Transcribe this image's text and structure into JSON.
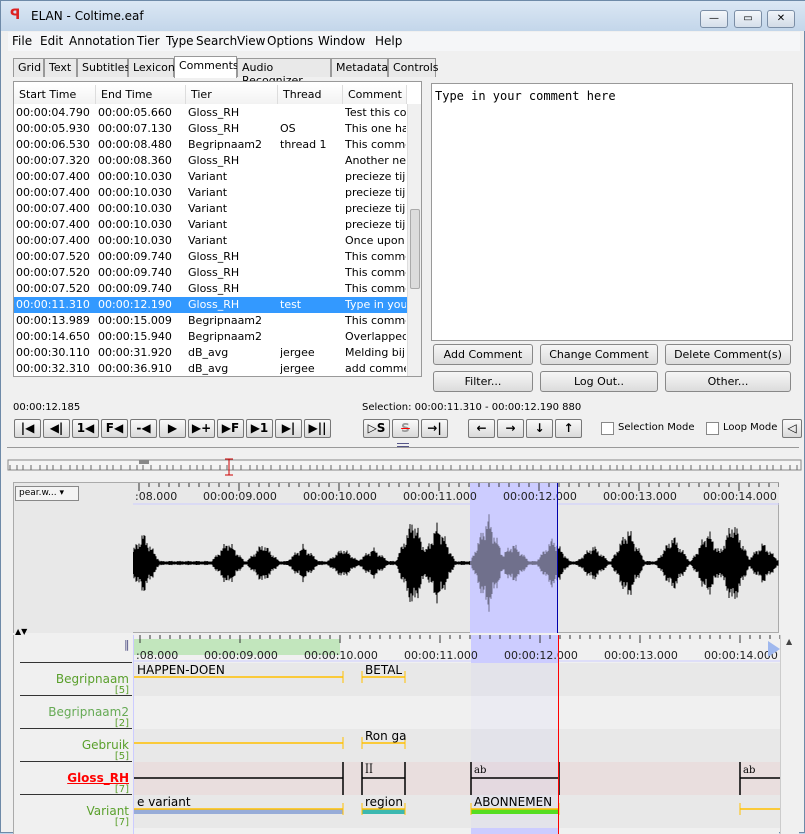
{
  "window": {
    "title": "ELAN - Coltime.eaf",
    "controls": [
      "—",
      "▭",
      "✕"
    ]
  },
  "menu": [
    "File",
    "Edit",
    "Annotation",
    "Tier",
    "Type",
    "Search",
    "View",
    "Options",
    "Window",
    "Help"
  ],
  "tabs": [
    {
      "label": "Grid"
    },
    {
      "label": "Text"
    },
    {
      "label": "Subtitles"
    },
    {
      "label": "Lexicon"
    },
    {
      "label": "Comments",
      "active": true
    },
    {
      "label": "Audio Recognizer"
    },
    {
      "label": "Metadata"
    },
    {
      "label": "Controls"
    }
  ],
  "comments_table": {
    "columns": [
      "Start Time",
      "End Time",
      "Tier",
      "Thread",
      "Comment"
    ],
    "rows": [
      [
        "00:00:04.790",
        "00:00:05.660",
        "Gloss_RH",
        "",
        "Test this com"
      ],
      [
        "00:00:05.930",
        "00:00:07.130",
        "Gloss_RH",
        "OS",
        "This one has"
      ],
      [
        "00:00:06.530",
        "00:00:08.480",
        "Begripnaam2",
        "thread 1",
        "This commen"
      ],
      [
        "00:00:07.320",
        "00:00:08.360",
        "Gloss_RH",
        "",
        "Another new"
      ],
      [
        "00:00:07.400",
        "00:00:10.030",
        "Variant",
        "",
        "precieze tijd"
      ],
      [
        "00:00:07.400",
        "00:00:10.030",
        "Variant",
        "",
        "precieze tijd"
      ],
      [
        "00:00:07.400",
        "00:00:10.030",
        "Variant",
        "",
        "precieze tijd"
      ],
      [
        "00:00:07.400",
        "00:00:10.030",
        "Variant",
        "",
        "precieze tijd"
      ],
      [
        "00:00:07.400",
        "00:00:10.030",
        "Variant",
        "",
        "Once upon a"
      ],
      [
        "00:00:07.520",
        "00:00:09.740",
        "Gloss_RH",
        "",
        "This commen"
      ],
      [
        "00:00:07.520",
        "00:00:09.740",
        "Gloss_RH",
        "",
        "This commen"
      ],
      [
        "00:00:07.520",
        "00:00:09.740",
        "Gloss_RH",
        "",
        "This commen"
      ],
      [
        "00:00:11.310",
        "00:00:12.190",
        "Gloss_RH",
        "test",
        "Type in your"
      ],
      [
        "00:00:13.989",
        "00:00:15.009",
        "Begripnaam2",
        "",
        "This commen"
      ],
      [
        "00:00:14.650",
        "00:00:15.940",
        "Begripnaam2",
        "",
        "Overlapped"
      ],
      [
        "00:00:30.110",
        "00:00:31.920",
        "dB_avg",
        "jergee",
        "Melding bij in"
      ],
      [
        "00:00:32.310",
        "00:00:36.910",
        "dB_avg",
        "jergee",
        "add commen"
      ]
    ],
    "selected_row": 12
  },
  "comment_editor": {
    "placeholder": "Type in your comment here"
  },
  "comment_buttons": {
    "add": "Add Comment",
    "change": "Change Comment",
    "delete": "Delete Comment(s)",
    "filter": "Filter...",
    "logout": "Log Out..",
    "other": "Other..."
  },
  "media": {
    "current_time": "00:00:12.185",
    "selection": "Selection: 00:00:11.310 - 00:00:12.190  880",
    "selection_mode": "Selection Mode",
    "loop_mode": "Loop Mode",
    "waveform_track": "pear.w..."
  },
  "transport": [
    "|◀",
    "◀|",
    "1◀",
    "F◀",
    "-◀",
    "▶",
    "▶+",
    "▶F",
    "▶1",
    "▶|",
    "▶||"
  ],
  "selection_buttons": [
    "▷S",
    "S",
    "→|"
  ],
  "nav_buttons": [
    "←",
    "→",
    "↓",
    "↑"
  ],
  "timeline": {
    "ticks": [
      ":08.000",
      "00:00:09.000",
      "00:00:10.000",
      "00:00:11.000",
      "00:00:12.000",
      "00:00:13.000",
      "00:00:14.000"
    ],
    "tick_times": [
      8,
      9,
      10,
      11,
      12,
      13,
      14
    ],
    "selection_start": 11.31,
    "selection_end": 12.19,
    "crosshair": 12.185,
    "tiers": [
      {
        "name": "Begripnaam",
        "count": "[5]",
        "color": "#5aa02c",
        "annotations": [
          {
            "start": 7.4,
            "end": 10.03,
            "text": "HAPPEN-DOEN"
          },
          {
            "start": 10.22,
            "end": 10.65,
            "text": "BETAL"
          }
        ]
      },
      {
        "name": "Begripnaam2",
        "count": "[2]",
        "color": "#66aa55",
        "annotations": []
      },
      {
        "name": "Gebruik",
        "count": "[5]",
        "color": "#5aa02c",
        "annotations": [
          {
            "start": 7.4,
            "end": 10.03,
            "text": ""
          },
          {
            "start": 10.22,
            "end": 10.65,
            "text": "Ron ga"
          }
        ]
      },
      {
        "name": "Gloss_RH",
        "count": "[7]",
        "color": "#ff0000",
        "active": true,
        "annotations": [
          {
            "start": 7.4,
            "end": 10.03,
            "text": ""
          },
          {
            "start": 10.22,
            "end": 10.65,
            "text": "ꟾꟾ"
          },
          {
            "start": 11.31,
            "end": 12.19,
            "text": "ab"
          },
          {
            "start": 14.0,
            "end": 15.0,
            "text": "ab"
          }
        ]
      },
      {
        "name": "Variant",
        "count": "[7]",
        "color": "#5aa02c",
        "annotations": [
          {
            "start": 7.4,
            "end": 10.03,
            "text": "e variant",
            "bar": "#97acd8"
          },
          {
            "start": 10.22,
            "end": 10.65,
            "text": "region",
            "bar": "#3bb8b0"
          },
          {
            "start": 11.31,
            "end": 12.19,
            "text": "ABONNEMEN",
            "bar": "#55dd22"
          },
          {
            "start": 14.0,
            "end": 15.0,
            "text": ""
          }
        ]
      }
    ]
  },
  "colors": {
    "selection": "#ccccff",
    "crosshair": "#ff0000",
    "annotation_line": "#ffc000"
  }
}
